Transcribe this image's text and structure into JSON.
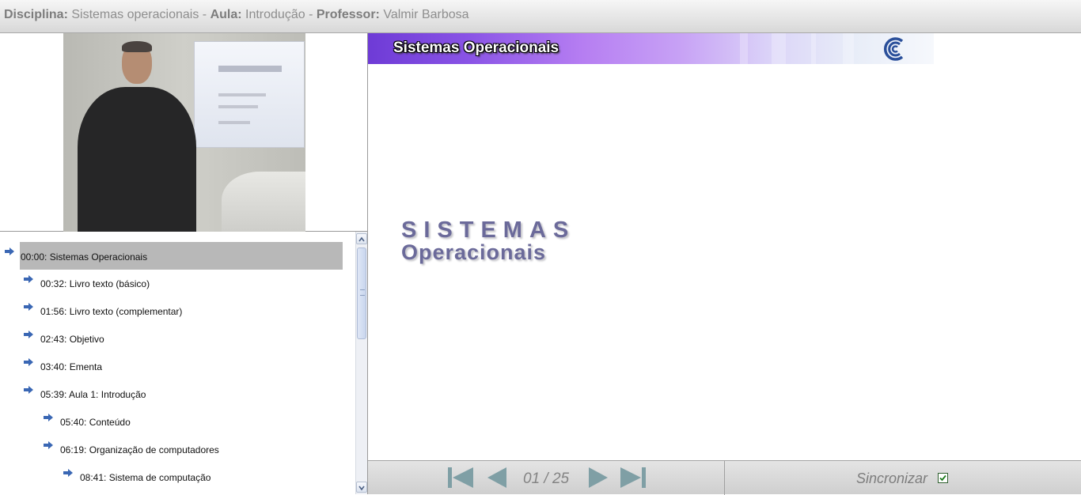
{
  "header": {
    "discipline_label": "Disciplina:",
    "discipline_value": "Sistemas operacionais",
    "separator": "-",
    "lesson_label": "Aula:",
    "lesson_value": "Introdução",
    "professor_label": "Professor:",
    "professor_value": "Valmir Barbosa"
  },
  "toc": {
    "items": [
      {
        "label": "00:00: Sistemas Operacionais",
        "level": 0,
        "selected": true
      },
      {
        "label": "00:32: Livro texto (básico)",
        "level": 1
      },
      {
        "label": "01:56: Livro texto (complementar)",
        "level": 1
      },
      {
        "label": "02:43: Objetivo",
        "level": 1
      },
      {
        "label": "03:40: Ementa",
        "level": 1
      },
      {
        "label": "05:39: Aula 1: Introdução",
        "level": 1
      },
      {
        "label": "05:40: Conteúdo",
        "level": 2
      },
      {
        "label": "06:19: Organização de computadores",
        "level": 2
      },
      {
        "label": "08:41: Sistema de computação",
        "level": 3
      }
    ]
  },
  "slide": {
    "banner_title": "Sistemas Operacionais",
    "heading_line1": "SISTEMAS",
    "heading_line2": "Operacionais"
  },
  "controls": {
    "page_counter": "01 / 25",
    "sync_label": "Sincronizar",
    "sync_checked": true
  },
  "colors": {
    "arrow_blue": "#3a67b4",
    "nav_teal": "#7f9fa5",
    "selected_bg": "#b8b8b8",
    "slide_heading": "#6b6a9a"
  }
}
